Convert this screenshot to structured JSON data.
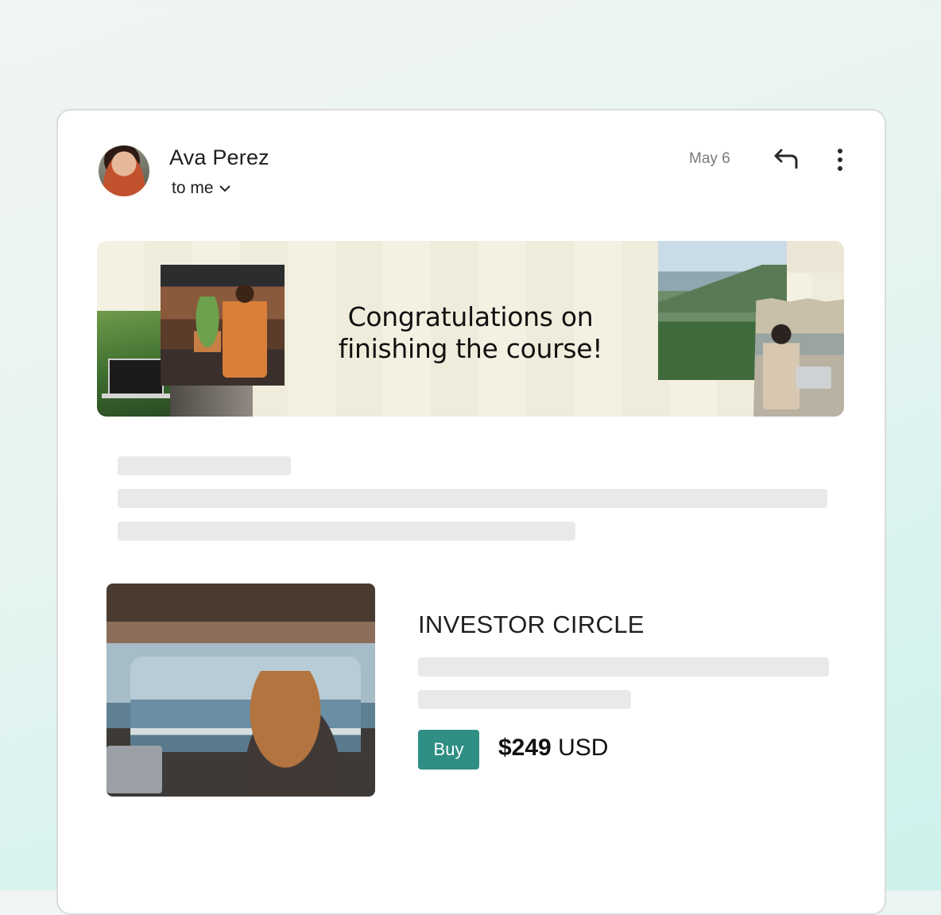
{
  "email": {
    "sender_name": "Ava Perez",
    "recipient_label": "to me",
    "date": "May 6"
  },
  "icons": {
    "reply": "reply-arrow-icon",
    "more": "more-vert-icon",
    "recipients_toggle": "chevron-down-icon"
  },
  "banner": {
    "headline_line1": "Congratulations on",
    "headline_line2": "finishing the course!"
  },
  "product": {
    "title": "INVESTOR CIRCLE",
    "buy_label": "Buy",
    "price_amount": "$249",
    "price_currency": "USD"
  },
  "colors": {
    "accent": "#2f8f84",
    "skeleton": "#e9e9e9"
  }
}
